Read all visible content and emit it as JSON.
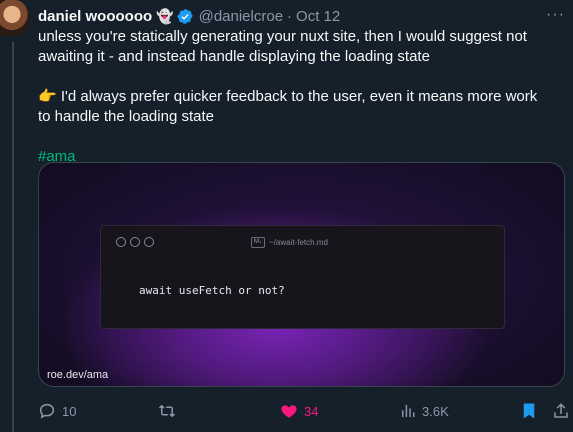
{
  "tweet": {
    "author": {
      "name": "daniel woooooo",
      "emoji": "👻",
      "handle": "@danielcroe",
      "separator": "·",
      "date": "Oct 12"
    },
    "text": {
      "line1": "unless you're statically generating your nuxt site, then I would suggest not awaiting it - and instead handle displaying the loading state",
      "line2": "👉 I'd always prefer quicker feedback to the user, even it means more work to handle the loading state",
      "hashtag": "#ama"
    },
    "media": {
      "file_tab_icon": "M↓",
      "file_tab": "~/await-fetch.md",
      "code": "await useFetch or not?",
      "caption": "roe.dev/ama"
    },
    "actions": {
      "replies": "10",
      "retweets": "",
      "likes": "34",
      "views": "3.6K"
    }
  },
  "colors": {
    "background": "#15202b",
    "secondary_text": "#8b98a5",
    "like_pink": "#f91880",
    "link_blue": "#1d9bf0",
    "hashtag_green": "#00ba7c"
  }
}
